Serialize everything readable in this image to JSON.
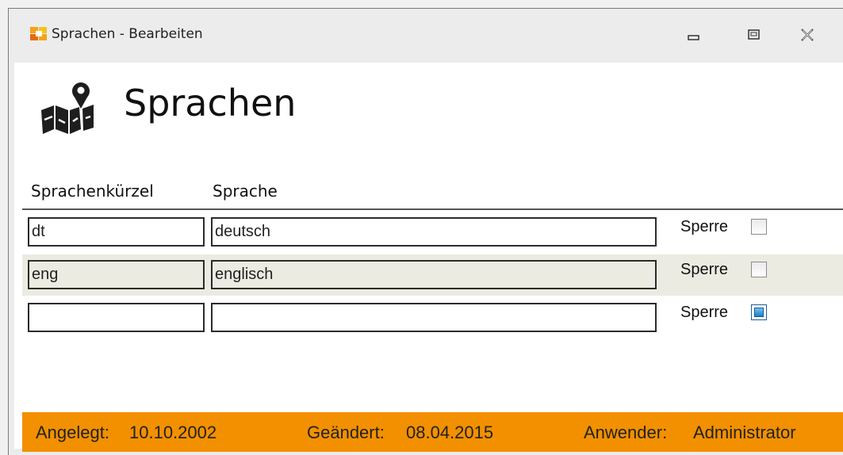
{
  "window": {
    "title": "Sprachen - Bearbeiten",
    "controls": [
      "minimize-icon",
      "maximize-icon",
      "close-icon"
    ]
  },
  "header": {
    "title": "Sprachen",
    "icon": "map-pin-icon"
  },
  "columns": {
    "code": "Sprachenkürzel",
    "language": "Sprache"
  },
  "rows": [
    {
      "code": "dt",
      "language": "deutsch",
      "lock_label": "Sperre",
      "locked": false,
      "focused": false
    },
    {
      "code": "eng",
      "language": "englisch",
      "lock_label": "Sperre",
      "locked": false,
      "focused": false
    },
    {
      "code": "",
      "language": "",
      "lock_label": "Sperre",
      "locked": false,
      "focused": true
    }
  ],
  "footer": {
    "created_label": "Angelegt:",
    "created_value": "10.10.2002",
    "changed_label": "Geändert:",
    "changed_value": "08.04.2015",
    "user_label": "Anwender:",
    "user_value": "Administrator"
  },
  "colors": {
    "footer_bg": "#f29000",
    "alt_row_bg": "#ecebe2"
  }
}
